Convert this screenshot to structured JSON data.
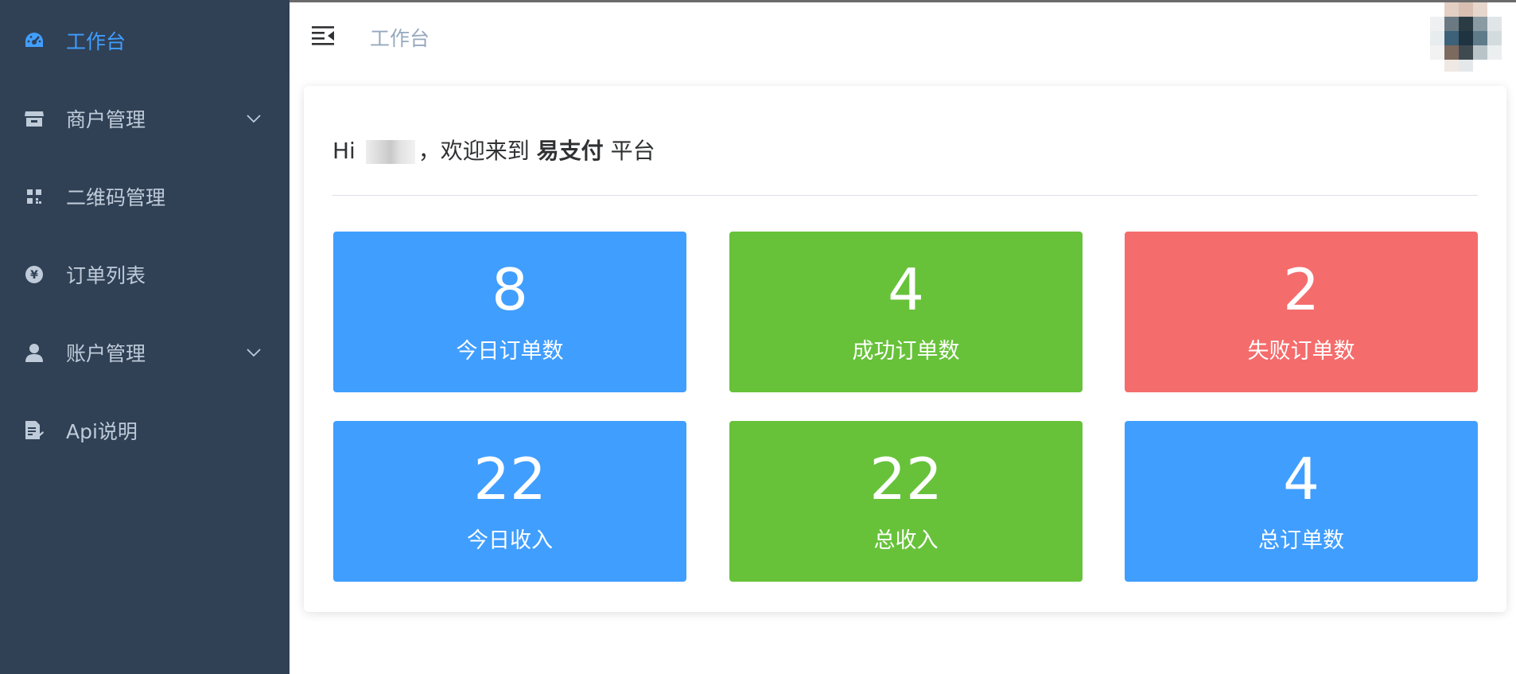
{
  "sidebar": {
    "items": [
      {
        "label": "工作台",
        "icon": "dashboard-icon"
      },
      {
        "label": "商户管理",
        "icon": "shop-icon"
      },
      {
        "label": "二维码管理",
        "icon": "qrcode-icon"
      },
      {
        "label": "订单列表",
        "icon": "yen-icon"
      },
      {
        "label": "账户管理",
        "icon": "user-icon"
      },
      {
        "label": "Api说明",
        "icon": "document-icon"
      }
    ]
  },
  "header": {
    "breadcrumb": "工作台"
  },
  "greeting": {
    "hi": "Hi",
    "welcome": "，欢迎来到",
    "brand": "易支付",
    "platform": "平台"
  },
  "stats": [
    {
      "value": "8",
      "label": "今日订单数",
      "color": "#409eff"
    },
    {
      "value": "4",
      "label": "成功订单数",
      "color": "#67c23a"
    },
    {
      "value": "2",
      "label": "失败订单数",
      "color": "#f56c6c"
    },
    {
      "value": "22",
      "label": "今日收入",
      "color": "#409eff"
    },
    {
      "value": "22",
      "label": "总收入",
      "color": "#67c23a"
    },
    {
      "value": "4",
      "label": "总订单数",
      "color": "#409eff"
    }
  ],
  "colors": {
    "sidebar_bg": "#304156",
    "active": "#409eff",
    "menu_text": "#bfcbd9"
  }
}
